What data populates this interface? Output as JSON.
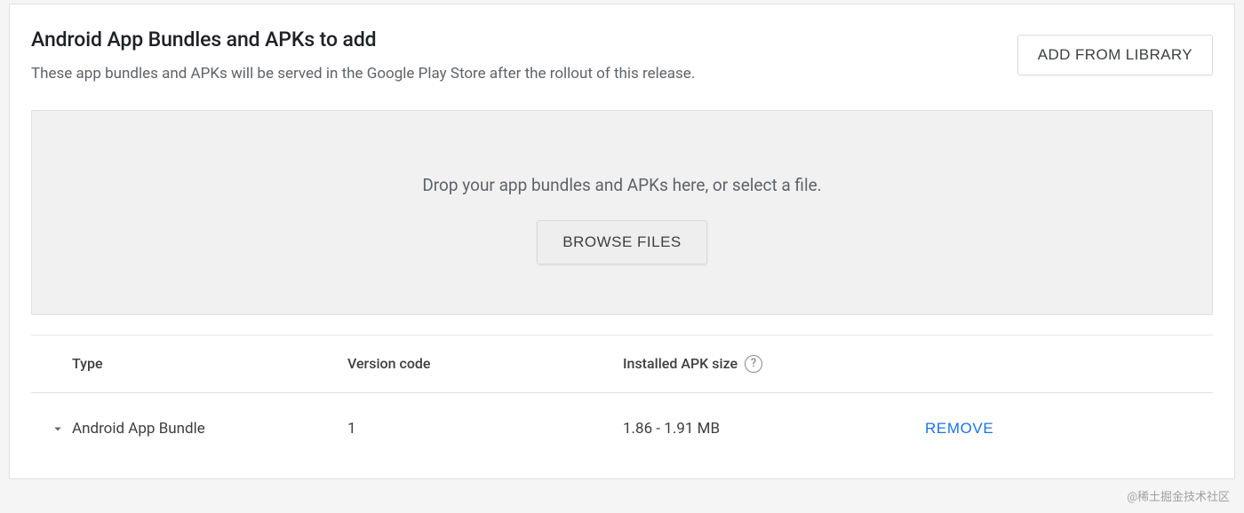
{
  "header": {
    "title": "Android App Bundles and APKs to add",
    "subtitle": "These app bundles and APKs will be served in the Google Play Store after the rollout of this release.",
    "add_from_library_label": "ADD FROM LIBRARY"
  },
  "dropzone": {
    "hint": "Drop your app bundles and APKs here, or select a file.",
    "browse_label": "BROWSE FILES"
  },
  "table": {
    "columns": {
      "type": "Type",
      "version_code": "Version code",
      "installed_apk_size": "Installed APK size"
    },
    "rows": [
      {
        "type": "Android App Bundle",
        "version_code": "1",
        "installed_apk_size": "1.86 - 1.91 MB",
        "action_label": "REMOVE"
      }
    ]
  },
  "watermark": "@稀土掘金技术社区",
  "help_icon_glyph": "?"
}
